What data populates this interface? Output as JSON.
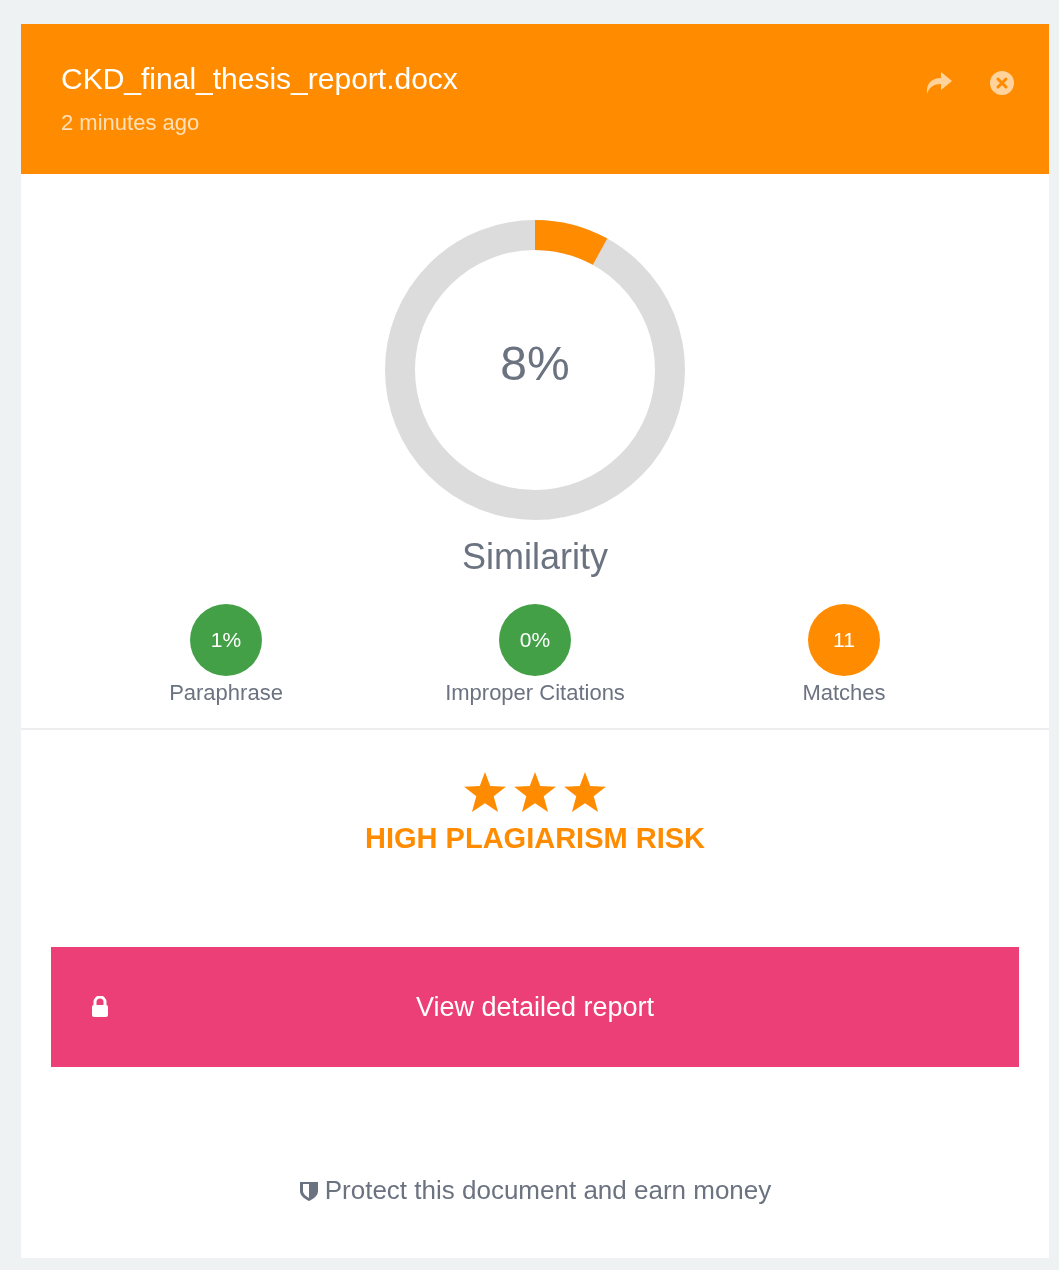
{
  "header": {
    "title": "CKD_final_thesis_report.docx",
    "time": "2 minutes ago"
  },
  "score": {
    "value": "8%",
    "level": 0.08,
    "label": "Similarity"
  },
  "stats": [
    {
      "value": "1%",
      "label": "Paraphrase",
      "color": "#43a047"
    },
    {
      "value": "0%",
      "label": "Improper Citations",
      "color": "#43a047"
    },
    {
      "value": "11",
      "label": "Matches",
      "color": "#ff8c00"
    }
  ],
  "risk": {
    "stars": 3,
    "label": "HIGH PLAGIARISM RISK"
  },
  "button": {
    "label": "View detailed report"
  },
  "footer": {
    "text": "Protect this document and earn money"
  }
}
